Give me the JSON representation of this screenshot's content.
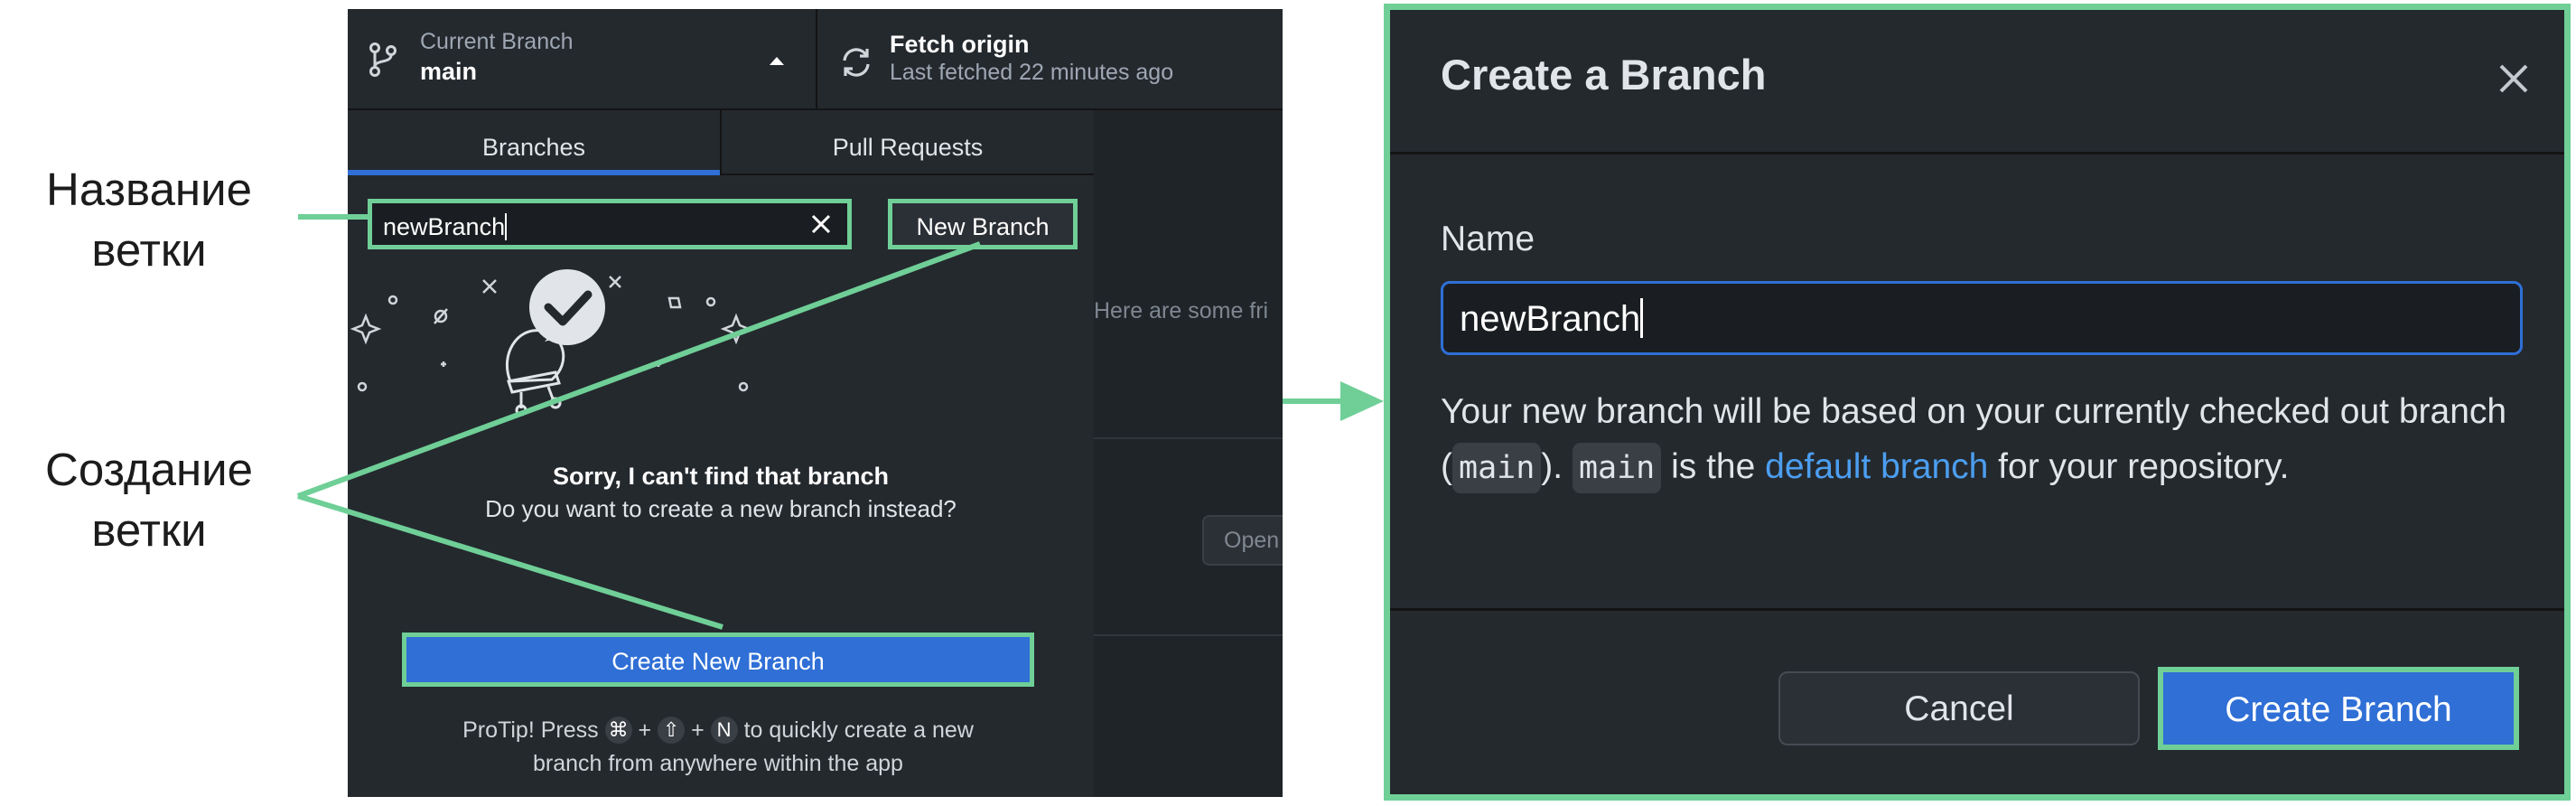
{
  "annotations": {
    "branch_name_label": [
      "Название",
      "ветки"
    ],
    "branch_create_label": [
      "Создание",
      "ветки"
    ],
    "highlight_color": "#6fcf97"
  },
  "toolbar": {
    "current_branch_caption": "Current Branch",
    "current_branch_name": "main",
    "fetch_title": "Fetch origin",
    "fetch_subtitle": "Last fetched 22 minutes ago"
  },
  "branch_list": {
    "tabs": [
      {
        "label": "Branches",
        "active": true
      },
      {
        "label": "Pull Requests",
        "active": false
      }
    ],
    "filter_value": "newBranch",
    "new_branch_button": "New Branch",
    "empty_title": "Sorry, I can't find that branch",
    "empty_subtitle": "Do you want to create a new branch instead?",
    "create_new_branch_button": "Create New Branch",
    "protip": {
      "prefix": "ProTip! Press",
      "keys": [
        "⌘",
        "+",
        "⇧",
        "+",
        "N"
      ],
      "suffix_line1": "to quickly create a new",
      "line2": "branch from anywhere within the app"
    }
  },
  "background_panel": {
    "hint_text": "Here are some fri",
    "open_button": "Open"
  },
  "dialog": {
    "title": "Create a Branch",
    "name_label": "Name",
    "name_value": "newBranch",
    "desc_part1": "Your new branch will be based on your currently checked out branch (",
    "desc_code1": "main",
    "desc_part2": "). ",
    "desc_code2": "main",
    "desc_part3": " is the ",
    "desc_link": "default branch",
    "desc_part4": " for your repository.",
    "cancel_button": "Cancel",
    "create_button": "Create Branch"
  },
  "colors": {
    "accent_blue": "#2f6fd6",
    "link_blue": "#4c9ef0",
    "panel_bg": "#24292e"
  },
  "icons": [
    "git-branch-icon",
    "caret-up-icon",
    "sync-icon",
    "close-icon",
    "checkmark-bubble-icon",
    "lightbulb-icon",
    "sparkle-icon"
  ]
}
